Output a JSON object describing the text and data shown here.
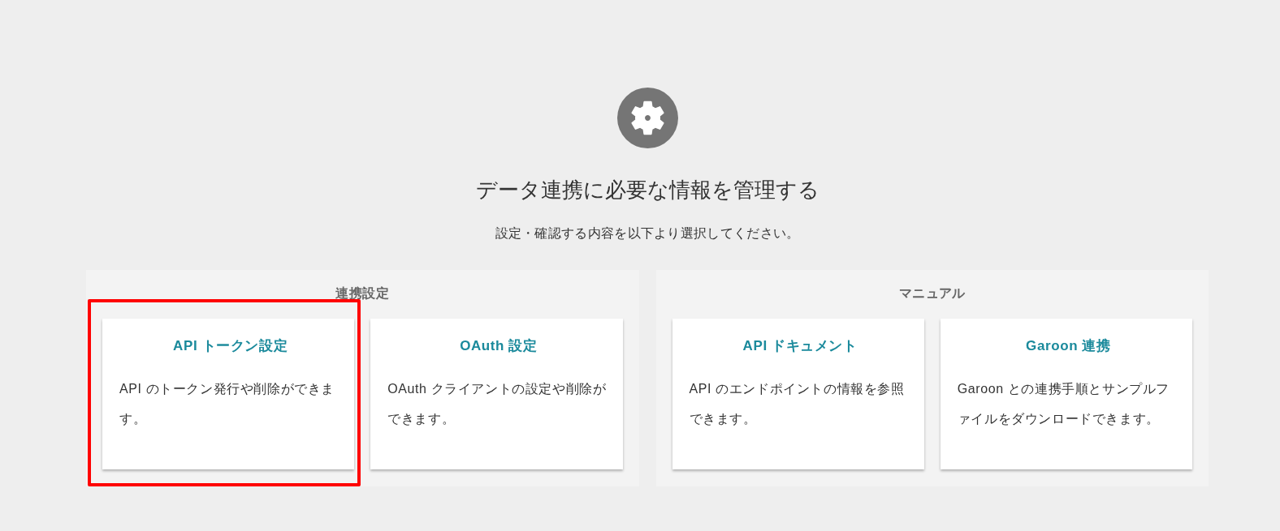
{
  "header": {
    "title": "データ連携に必要な情報を管理する",
    "subtitle": "設定・確認する内容を以下より選択してください。"
  },
  "sections": [
    {
      "title": "連携設定",
      "cards": [
        {
          "title": "API トークン設定",
          "description": "API のトークン発行や削除ができます。",
          "highlighted": true
        },
        {
          "title": "OAuth 設定",
          "description": "OAuth クライアントの設定や削除ができます。",
          "highlighted": false
        }
      ]
    },
    {
      "title": "マニュアル",
      "cards": [
        {
          "title": "API ドキュメント",
          "description": "API のエンドポイントの情報を参照できます。",
          "highlighted": false
        },
        {
          "title": "Garoon 連携",
          "description": "Garoon との連携手順とサンプルファイルをダウンロードできます。",
          "highlighted": false
        }
      ]
    }
  ]
}
